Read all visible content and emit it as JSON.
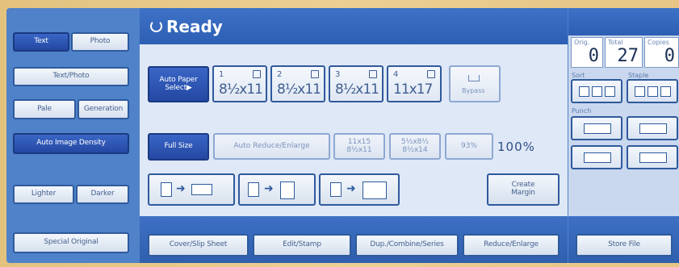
{
  "status": {
    "text": "Ready"
  },
  "left": {
    "text_label": "Text",
    "photo_label": "Photo",
    "text_photo_label": "Text/Photo",
    "pale_label": "Pale",
    "generation_label": "Generation",
    "auto_density_label": "Auto Image Density",
    "lighter_label": "Lighter",
    "darker_label": "Darker",
    "special_original_label": "Special Original"
  },
  "paper": {
    "auto_select_label_1": "Auto Paper",
    "auto_select_label_2": "Select▶",
    "trays": [
      {
        "num": "1",
        "size": "8½x11"
      },
      {
        "num": "2",
        "size": "8½x11"
      },
      {
        "num": "3",
        "size": "8½x11"
      },
      {
        "num": "4",
        "size": "11x17"
      }
    ],
    "bypass_label": "Bypass"
  },
  "ratio": {
    "full_size_label": "Full Size",
    "auto_reduce_enlarge_label": "Auto Reduce/Enlarge",
    "preset_1_line1": "11x15",
    "preset_1_line2": "8½x11",
    "preset_2_line1": "5½x8½",
    "preset_2_line2": "8½x14",
    "preset_3_label": "93%",
    "current_ratio": "100%"
  },
  "combine": {
    "create_margin_label_1": "Create",
    "create_margin_label_2": "Margin"
  },
  "bottom": {
    "cover_slip_label": "Cover/Slip Sheet",
    "edit_stamp_label": "Edit/Stamp",
    "dup_combine_label": "Dup./Combine/Series",
    "reduce_enlarge_label": "Reduce/Enlarge",
    "store_file_label": "Store File"
  },
  "counters": {
    "originals_label": "Orig.",
    "originals_value": "0",
    "total_label": "Total",
    "total_value": "27",
    "copies_label": "Copies",
    "copies_value": "0"
  },
  "right": {
    "sort_label": "Sort",
    "staple_label": "Staple",
    "punch_label": "Punch"
  },
  "colors": {
    "screen_blue": "#4f82c9",
    "button_border": "#2f5a9c",
    "selected_fill": "#2a52ad"
  }
}
